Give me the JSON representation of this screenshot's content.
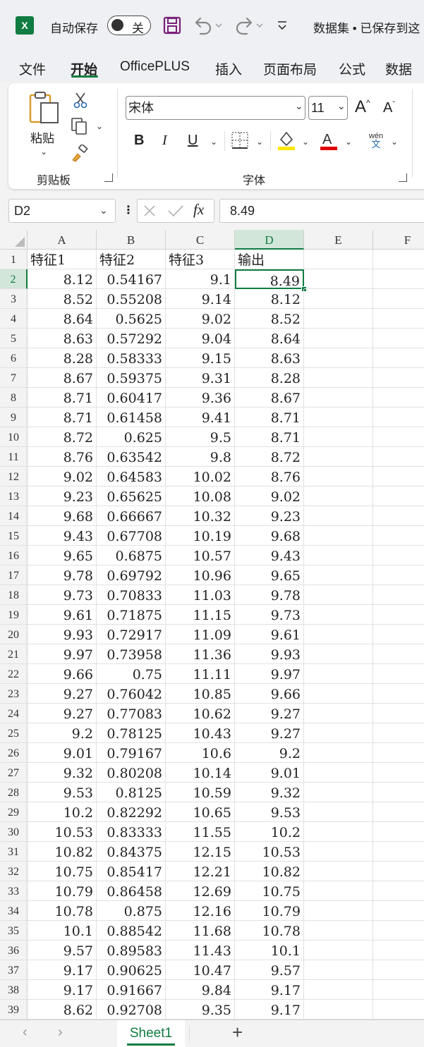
{
  "titlebar": {
    "autosave_label": "自动保存",
    "autosave_state": "关",
    "document_title": "数据集 • 已保存到这"
  },
  "tabs": [
    {
      "label": "文件",
      "active": false
    },
    {
      "label": "开始",
      "active": true
    },
    {
      "label": "OfficePLUS",
      "active": false
    },
    {
      "label": "插入",
      "active": false
    },
    {
      "label": "页面布局",
      "active": false
    },
    {
      "label": "公式",
      "active": false
    },
    {
      "label": "数据",
      "active": false
    }
  ],
  "ribbon": {
    "paste_label": "粘贴",
    "clipboard_group": "剪贴板",
    "font_group": "字体",
    "font_name": "宋体",
    "font_size": "11",
    "bold": "B",
    "italic": "I",
    "underline": "U",
    "phonetic_top": "wén",
    "phonetic_bottom": "文",
    "highlight_color": "#ffff00",
    "font_color": "#e00000"
  },
  "formula_bar": {
    "name_box": "D2",
    "fx": "fx",
    "value": "8.49"
  },
  "grid": {
    "columns": [
      "A",
      "B",
      "C",
      "D",
      "E",
      "F"
    ],
    "selected_column": "D",
    "selected_row": "2",
    "rows": [
      {
        "n": "1",
        "a": "特征1",
        "b": "特征2",
        "c": "特征3",
        "d": "输出"
      },
      {
        "n": "2",
        "a": "8.12",
        "b": "0.54167",
        "c": "9.1",
        "d": "8.49"
      },
      {
        "n": "3",
        "a": "8.52",
        "b": "0.55208",
        "c": "9.14",
        "d": "8.12"
      },
      {
        "n": "4",
        "a": "8.64",
        "b": "0.5625",
        "c": "9.02",
        "d": "8.52"
      },
      {
        "n": "5",
        "a": "8.63",
        "b": "0.57292",
        "c": "9.04",
        "d": "8.64"
      },
      {
        "n": "6",
        "a": "8.28",
        "b": "0.58333",
        "c": "9.15",
        "d": "8.63"
      },
      {
        "n": "7",
        "a": "8.67",
        "b": "0.59375",
        "c": "9.31",
        "d": "8.28"
      },
      {
        "n": "8",
        "a": "8.71",
        "b": "0.60417",
        "c": "9.36",
        "d": "8.67"
      },
      {
        "n": "9",
        "a": "8.71",
        "b": "0.61458",
        "c": "9.41",
        "d": "8.71"
      },
      {
        "n": "10",
        "a": "8.72",
        "b": "0.625",
        "c": "9.5",
        "d": "8.71"
      },
      {
        "n": "11",
        "a": "8.76",
        "b": "0.63542",
        "c": "9.8",
        "d": "8.72"
      },
      {
        "n": "12",
        "a": "9.02",
        "b": "0.64583",
        "c": "10.02",
        "d": "8.76"
      },
      {
        "n": "13",
        "a": "9.23",
        "b": "0.65625",
        "c": "10.08",
        "d": "9.02"
      },
      {
        "n": "14",
        "a": "9.68",
        "b": "0.66667",
        "c": "10.32",
        "d": "9.23"
      },
      {
        "n": "15",
        "a": "9.43",
        "b": "0.67708",
        "c": "10.19",
        "d": "9.68"
      },
      {
        "n": "16",
        "a": "9.65",
        "b": "0.6875",
        "c": "10.57",
        "d": "9.43"
      },
      {
        "n": "17",
        "a": "9.78",
        "b": "0.69792",
        "c": "10.96",
        "d": "9.65"
      },
      {
        "n": "18",
        "a": "9.73",
        "b": "0.70833",
        "c": "11.03",
        "d": "9.78"
      },
      {
        "n": "19",
        "a": "9.61",
        "b": "0.71875",
        "c": "11.15",
        "d": "9.73"
      },
      {
        "n": "20",
        "a": "9.93",
        "b": "0.72917",
        "c": "11.09",
        "d": "9.61"
      },
      {
        "n": "21",
        "a": "9.97",
        "b": "0.73958",
        "c": "11.36",
        "d": "9.93"
      },
      {
        "n": "22",
        "a": "9.66",
        "b": "0.75",
        "c": "11.11",
        "d": "9.97"
      },
      {
        "n": "23",
        "a": "9.27",
        "b": "0.76042",
        "c": "10.85",
        "d": "9.66"
      },
      {
        "n": "24",
        "a": "9.27",
        "b": "0.77083",
        "c": "10.62",
        "d": "9.27"
      },
      {
        "n": "25",
        "a": "9.2",
        "b": "0.78125",
        "c": "10.43",
        "d": "9.27"
      },
      {
        "n": "26",
        "a": "9.01",
        "b": "0.79167",
        "c": "10.6",
        "d": "9.2"
      },
      {
        "n": "27",
        "a": "9.32",
        "b": "0.80208",
        "c": "10.14",
        "d": "9.01"
      },
      {
        "n": "28",
        "a": "9.53",
        "b": "0.8125",
        "c": "10.59",
        "d": "9.32"
      },
      {
        "n": "29",
        "a": "10.2",
        "b": "0.82292",
        "c": "10.65",
        "d": "9.53"
      },
      {
        "n": "30",
        "a": "10.53",
        "b": "0.83333",
        "c": "11.55",
        "d": "10.2"
      },
      {
        "n": "31",
        "a": "10.82",
        "b": "0.84375",
        "c": "12.15",
        "d": "10.53"
      },
      {
        "n": "32",
        "a": "10.75",
        "b": "0.85417",
        "c": "12.21",
        "d": "10.82"
      },
      {
        "n": "33",
        "a": "10.79",
        "b": "0.86458",
        "c": "12.69",
        "d": "10.75"
      },
      {
        "n": "34",
        "a": "10.78",
        "b": "0.875",
        "c": "12.16",
        "d": "10.79"
      },
      {
        "n": "35",
        "a": "10.1",
        "b": "0.88542",
        "c": "11.68",
        "d": "10.78"
      },
      {
        "n": "36",
        "a": "9.57",
        "b": "0.89583",
        "c": "11.43",
        "d": "10.1"
      },
      {
        "n": "37",
        "a": "9.17",
        "b": "0.90625",
        "c": "10.47",
        "d": "9.57"
      },
      {
        "n": "38",
        "a": "9.17",
        "b": "0.91667",
        "c": "9.84",
        "d": "9.17"
      },
      {
        "n": "39",
        "a": "8.62",
        "b": "0.92708",
        "c": "9.35",
        "d": "9.17"
      }
    ]
  },
  "sheetbar": {
    "sheet_name": "Sheet1",
    "add_label": "+"
  }
}
